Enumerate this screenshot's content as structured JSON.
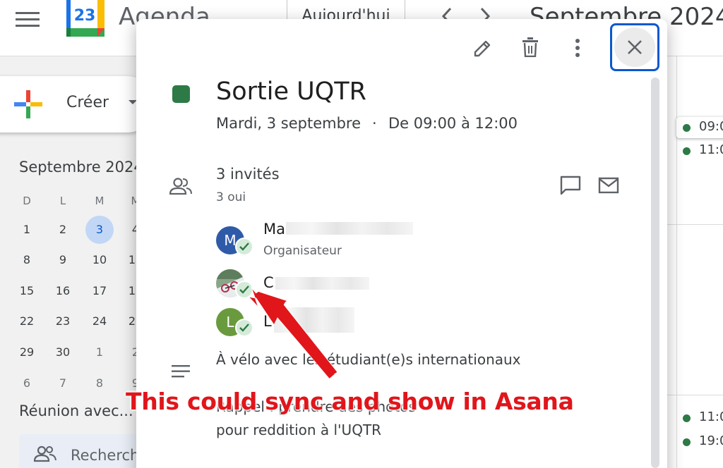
{
  "header": {
    "app_title": "Agenda",
    "logo_day": "23",
    "today_button": "Aujourd'hui",
    "month_title": "Septembre 2024"
  },
  "sidebar": {
    "create_label": "Créer",
    "mini_calendar": {
      "title": "Septembre 2024",
      "weekdays": [
        "D",
        "L",
        "M",
        "M"
      ],
      "rows": [
        [
          "1",
          "2",
          "3",
          "4"
        ],
        [
          "8",
          "9",
          "10",
          "11"
        ],
        [
          "15",
          "16",
          "17",
          "18"
        ],
        [
          "22",
          "23",
          "24",
          "25"
        ],
        [
          "29",
          "30",
          "1",
          "2"
        ],
        [
          "6",
          "7",
          "8",
          "9"
        ]
      ],
      "selected_day": "3"
    },
    "meet_title": "Réunion avec...",
    "search_people_placeholder": "Rechercher des personnes"
  },
  "week_view": {
    "chips": [
      "09:00",
      "11:00",
      "11:00",
      "19:00"
    ]
  },
  "event": {
    "color": "#2d7a46",
    "title": "Sortie UQTR",
    "date": "Mardi, 3 septembre",
    "separator": "·",
    "time": "De 09:00 à 12:00",
    "guests_count": "3 invités",
    "guests_yes": "3 oui",
    "guests": [
      {
        "initial": "M",
        "name_visible": "Ma",
        "role": "Organisateur",
        "avatar_color": "#2f5aa8"
      },
      {
        "initial": "",
        "name_visible": "C",
        "role": "",
        "avatar_color": "#7a9a7a"
      },
      {
        "initial": "L",
        "name_visible": "L",
        "role": "",
        "avatar_color": "#6a9a3e"
      }
    ],
    "description_line1": "À vélo avec les étudiant(e)s internationaux",
    "description_line2": "Rappel : prendre des photos",
    "description_line3": "pour reddition à l'UQTR"
  },
  "annotation": {
    "text": "This could sync and show in Asana",
    "color": "#e0161b"
  },
  "icons": [
    "menu-icon",
    "pencil-icon",
    "trash-icon",
    "more-vert-icon",
    "close-icon",
    "people-icon",
    "chat-icon",
    "mail-icon",
    "notes-icon",
    "check-icon"
  ]
}
